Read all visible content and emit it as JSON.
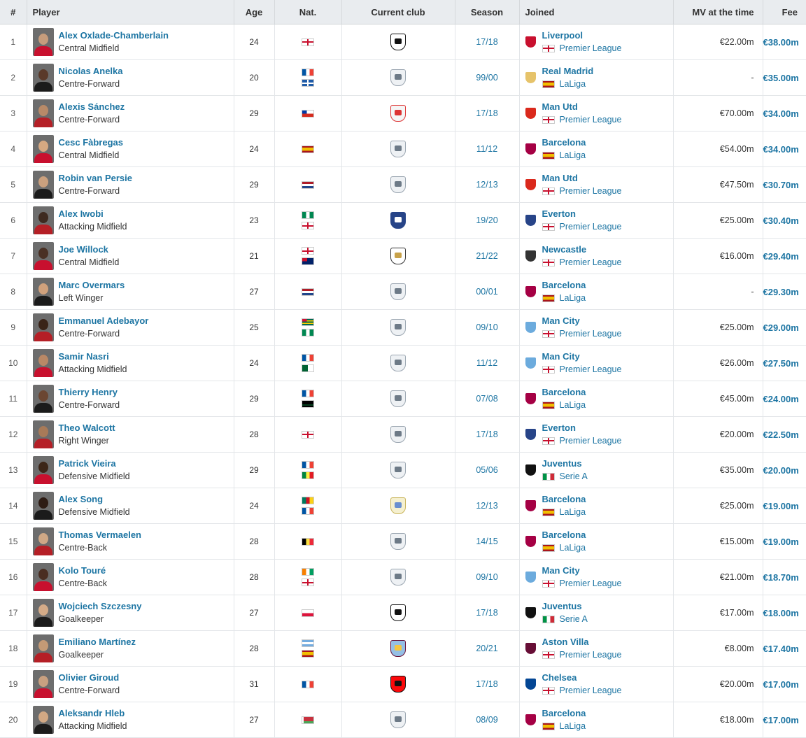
{
  "headers": {
    "rank": "#",
    "player": "Player",
    "age": "Age",
    "nat": "Nat.",
    "club": "Current club",
    "season": "Season",
    "joined": "Joined",
    "mv": "MV at the time",
    "fee": "Fee"
  },
  "colors": {
    "link": "#1d75a3",
    "header_bg": "#e9ecef"
  },
  "rows": [
    {
      "rank": "1",
      "name": "Alex Oxlade-Chamberlain",
      "position": "Central Midfield",
      "age": "24",
      "nat": [
        "england"
      ],
      "club": "besiktas",
      "season": "17/18",
      "joined": "Liverpool",
      "league": "Premier League",
      "league_flag": "england",
      "mv": "€22.00m",
      "fee": "€38.00m"
    },
    {
      "rank": "2",
      "name": "Nicolas Anelka",
      "position": "Centre-Forward",
      "age": "20",
      "nat": [
        "france",
        "martinique"
      ],
      "club": "retired",
      "season": "99/00",
      "joined": "Real Madrid",
      "league": "LaLiga",
      "league_flag": "spain",
      "mv": "-",
      "fee": "€35.00m"
    },
    {
      "rank": "3",
      "name": "Alexis Sánchez",
      "position": "Centre-Forward",
      "age": "29",
      "nat": [
        "chile"
      ],
      "club": "without-club",
      "season": "17/18",
      "joined": "Man Utd",
      "league": "Premier League",
      "league_flag": "england",
      "mv": "€70.00m",
      "fee": "€34.00m"
    },
    {
      "rank": "4",
      "name": "Cesc Fàbregas",
      "position": "Central Midfield",
      "age": "24",
      "nat": [
        "spain"
      ],
      "club": "retired",
      "season": "11/12",
      "joined": "Barcelona",
      "league": "LaLiga",
      "league_flag": "spain",
      "mv": "€54.00m",
      "fee": "€34.00m"
    },
    {
      "rank": "5",
      "name": "Robin van Persie",
      "position": "Centre-Forward",
      "age": "29",
      "nat": [
        "netherlands"
      ],
      "club": "retired",
      "season": "12/13",
      "joined": "Man Utd",
      "league": "Premier League",
      "league_flag": "england",
      "mv": "€47.50m",
      "fee": "€30.70m"
    },
    {
      "rank": "6",
      "name": "Alex Iwobi",
      "position": "Attacking Midfield",
      "age": "23",
      "nat": [
        "nigeria",
        "england"
      ],
      "club": "everton",
      "season": "19/20",
      "joined": "Everton",
      "league": "Premier League",
      "league_flag": "england",
      "mv": "€25.00m",
      "fee": "€30.40m"
    },
    {
      "rank": "7",
      "name": "Joe Willock",
      "position": "Central Midfield",
      "age": "21",
      "nat": [
        "england",
        "montserrat"
      ],
      "club": "newcastle",
      "season": "21/22",
      "joined": "Newcastle",
      "league": "Premier League",
      "league_flag": "england",
      "mv": "€16.00m",
      "fee": "€29.40m"
    },
    {
      "rank": "8",
      "name": "Marc Overmars",
      "position": "Left Winger",
      "age": "27",
      "nat": [
        "netherlands"
      ],
      "club": "retired",
      "season": "00/01",
      "joined": "Barcelona",
      "league": "LaLiga",
      "league_flag": "spain",
      "mv": "-",
      "fee": "€29.30m"
    },
    {
      "rank": "9",
      "name": "Emmanuel Adebayor",
      "position": "Centre-Forward",
      "age": "25",
      "nat": [
        "togo",
        "nigeria"
      ],
      "club": "retired",
      "season": "09/10",
      "joined": "Man City",
      "league": "Premier League",
      "league_flag": "england",
      "mv": "€25.00m",
      "fee": "€29.00m"
    },
    {
      "rank": "10",
      "name": "Samir Nasri",
      "position": "Attacking Midfield",
      "age": "24",
      "nat": [
        "france",
        "algeria"
      ],
      "club": "retired",
      "season": "11/12",
      "joined": "Man City",
      "league": "Premier League",
      "league_flag": "england",
      "mv": "€26.00m",
      "fee": "€27.50m"
    },
    {
      "rank": "11",
      "name": "Thierry Henry",
      "position": "Centre-Forward",
      "age": "29",
      "nat": [
        "france",
        "guadeloupe"
      ],
      "club": "retired",
      "season": "07/08",
      "joined": "Barcelona",
      "league": "LaLiga",
      "league_flag": "spain",
      "mv": "€45.00m",
      "fee": "€24.00m"
    },
    {
      "rank": "12",
      "name": "Theo Walcott",
      "position": "Right Winger",
      "age": "28",
      "nat": [
        "england"
      ],
      "club": "retired",
      "season": "17/18",
      "joined": "Everton",
      "league": "Premier League",
      "league_flag": "england",
      "mv": "€20.00m",
      "fee": "€22.50m"
    },
    {
      "rank": "13",
      "name": "Patrick Vieira",
      "position": "Defensive Midfield",
      "age": "29",
      "nat": [
        "france",
        "senegal"
      ],
      "club": "retired",
      "season": "05/06",
      "joined": "Juventus",
      "league": "Serie A",
      "league_flag": "italy",
      "mv": "€35.00m",
      "fee": "€20.00m"
    },
    {
      "rank": "14",
      "name": "Alex Song",
      "position": "Defensive Midfield",
      "age": "24",
      "nat": [
        "cameroon",
        "france"
      ],
      "club": "djibouti-club",
      "season": "12/13",
      "joined": "Barcelona",
      "league": "LaLiga",
      "league_flag": "spain",
      "mv": "€25.00m",
      "fee": "€19.00m"
    },
    {
      "rank": "15",
      "name": "Thomas Vermaelen",
      "position": "Centre-Back",
      "age": "28",
      "nat": [
        "belgium"
      ],
      "club": "retired",
      "season": "14/15",
      "joined": "Barcelona",
      "league": "LaLiga",
      "league_flag": "spain",
      "mv": "€15.00m",
      "fee": "€19.00m"
    },
    {
      "rank": "16",
      "name": "Kolo Touré",
      "position": "Centre-Back",
      "age": "28",
      "nat": [
        "ivory-coast",
        "england"
      ],
      "club": "retired",
      "season": "09/10",
      "joined": "Man City",
      "league": "Premier League",
      "league_flag": "england",
      "mv": "€21.00m",
      "fee": "€18.70m"
    },
    {
      "rank": "17",
      "name": "Wojciech Szczesny",
      "position": "Goalkeeper",
      "age": "27",
      "nat": [
        "poland"
      ],
      "club": "juventus",
      "season": "17/18",
      "joined": "Juventus",
      "league": "Serie A",
      "league_flag": "italy",
      "mv": "€17.00m",
      "fee": "€18.00m"
    },
    {
      "rank": "18",
      "name": "Emiliano Martínez",
      "position": "Goalkeeper",
      "age": "28",
      "nat": [
        "argentina",
        "spain"
      ],
      "club": "aston-villa",
      "season": "20/21",
      "joined": "Aston Villa",
      "league": "Premier League",
      "league_flag": "england",
      "mv": "€8.00m",
      "fee": "€17.40m"
    },
    {
      "rank": "19",
      "name": "Olivier Giroud",
      "position": "Centre-Forward",
      "age": "31",
      "nat": [
        "france"
      ],
      "club": "ac-milan",
      "season": "17/18",
      "joined": "Chelsea",
      "league": "Premier League",
      "league_flag": "england",
      "mv": "€20.00m",
      "fee": "€17.00m"
    },
    {
      "rank": "20",
      "name": "Aleksandr Hleb",
      "position": "Attacking Midfield",
      "age": "27",
      "nat": [
        "belarus"
      ],
      "club": "retired",
      "season": "08/09",
      "joined": "Barcelona",
      "league": "LaLiga",
      "league_flag": "spain",
      "mv": "€18.00m",
      "fee": "€17.00m"
    }
  ]
}
